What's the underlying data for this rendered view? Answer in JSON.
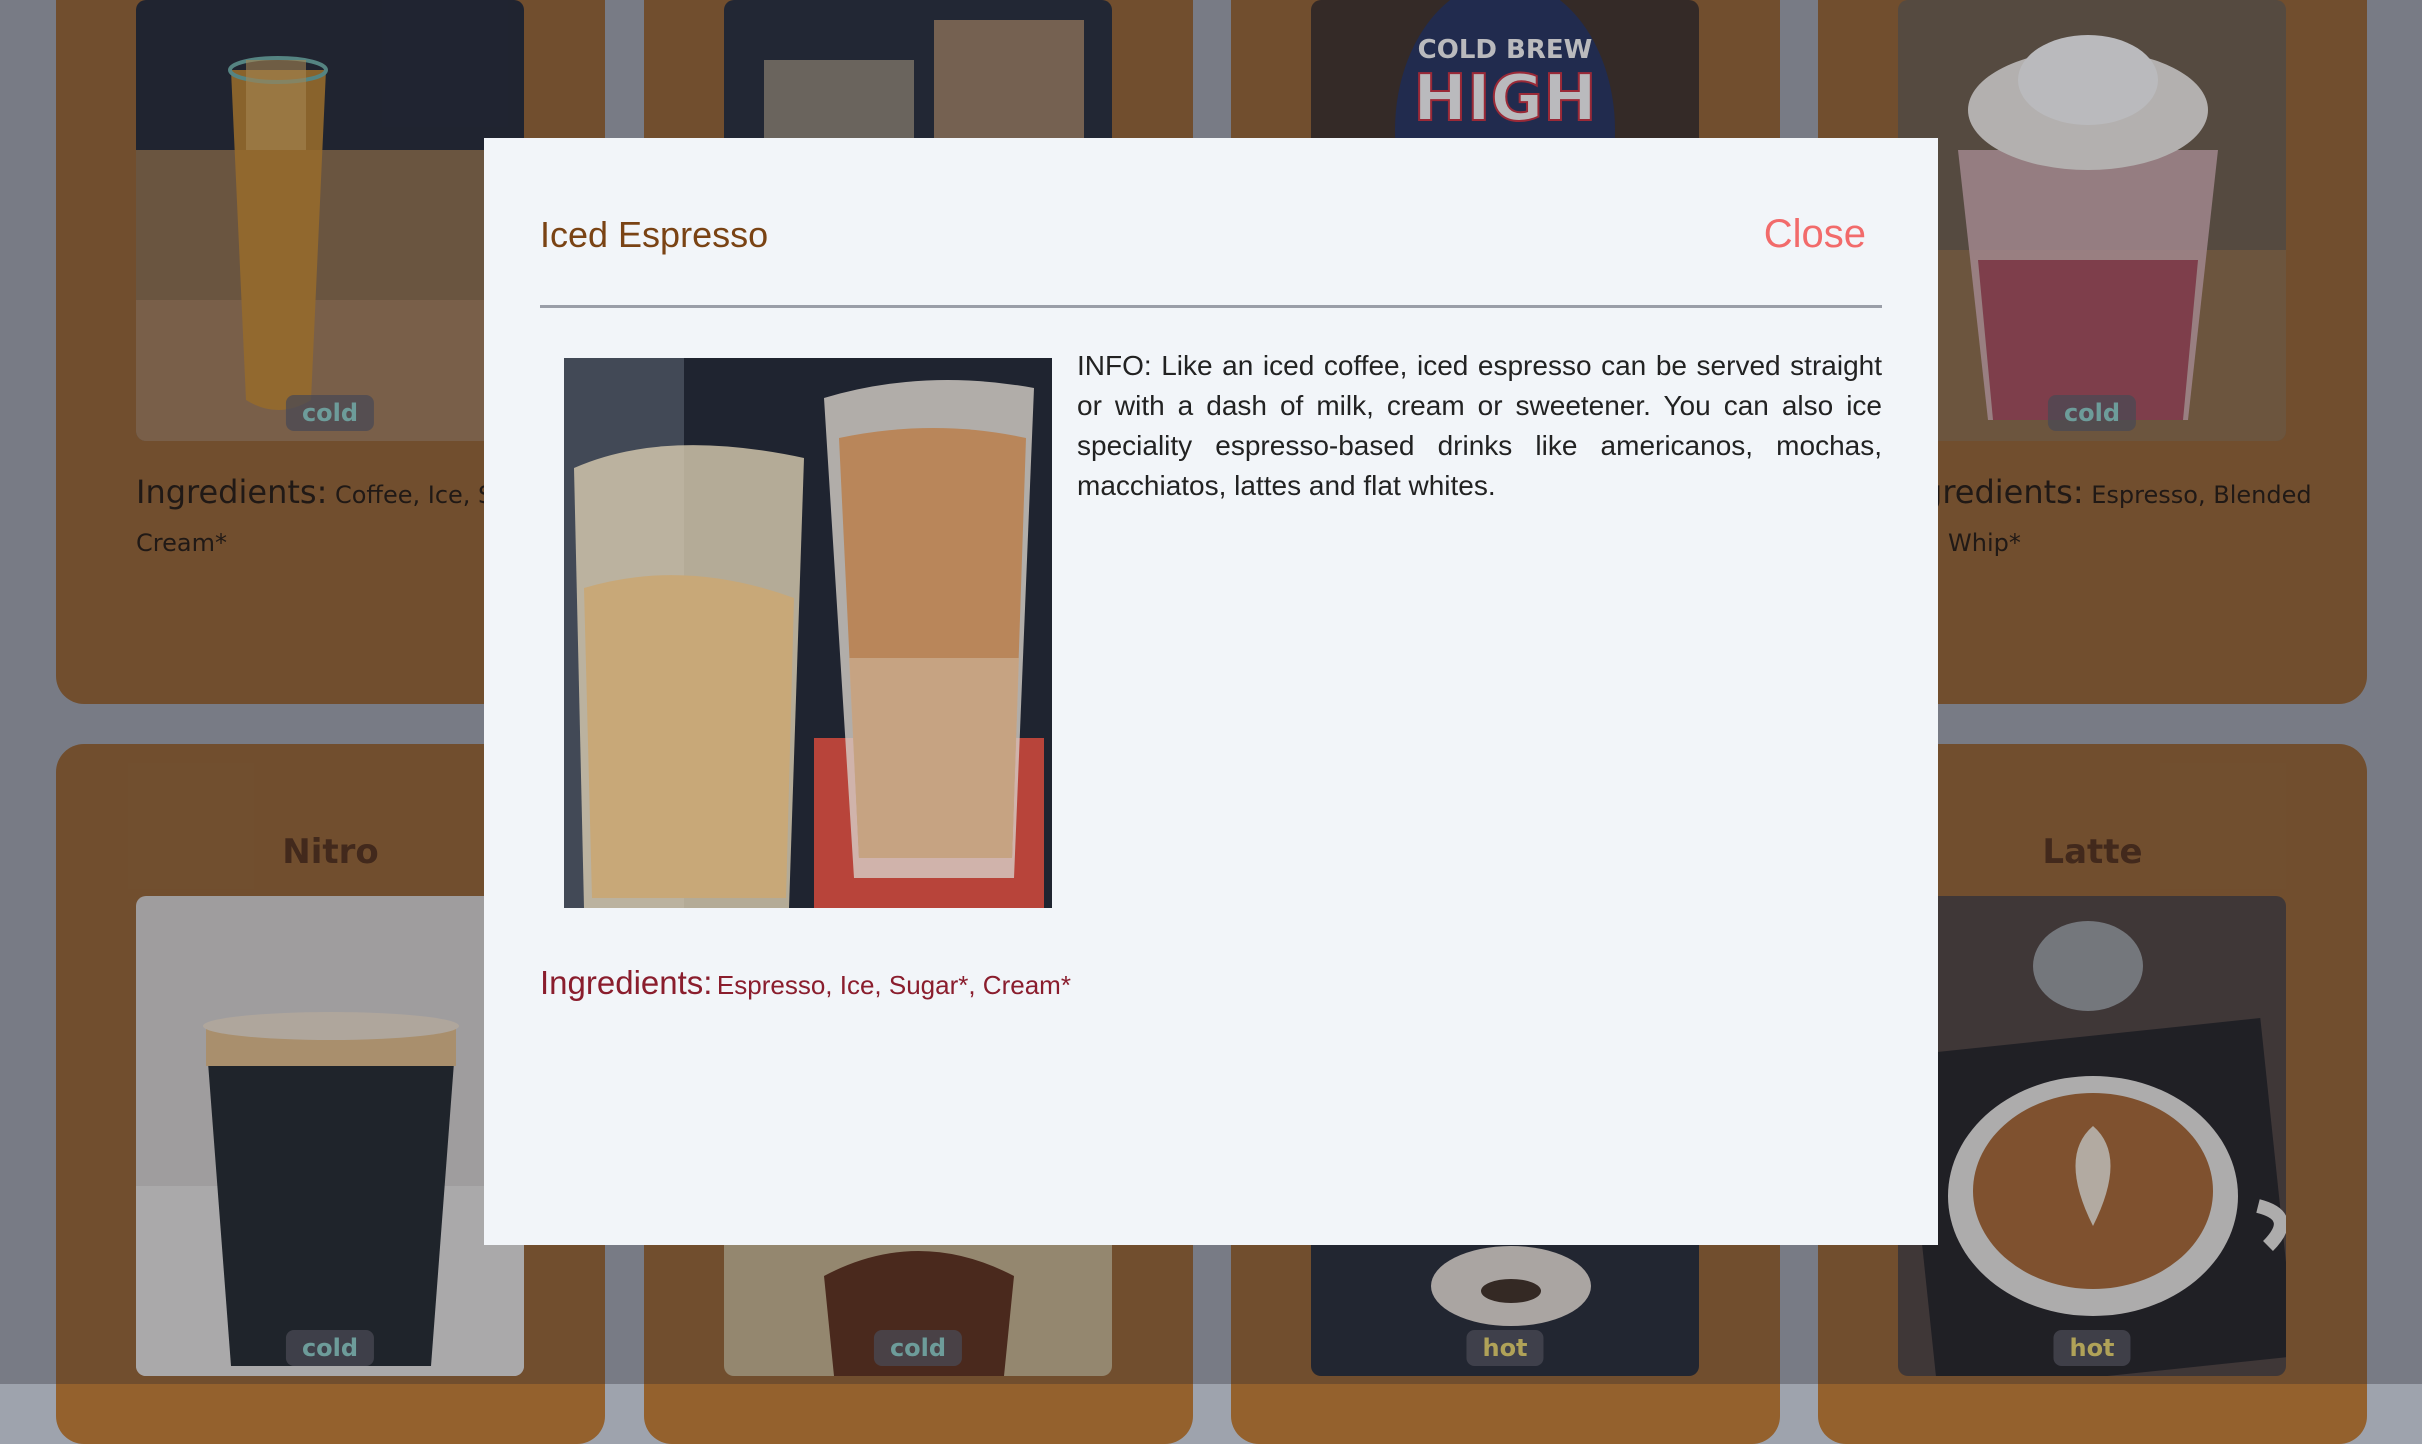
{
  "background_cards": [
    {
      "position": "row1-col1",
      "temp": "cold",
      "ingredients_label": "Ingredients:",
      "ingredients_text": "Coffee, Ice, Sug",
      "ingredients_text_2": "Cream*"
    },
    {
      "position": "row1-col2"
    },
    {
      "position": "row1-col3",
      "sign_line1": "COLD BREW",
      "sign_line2": "HIGH"
    },
    {
      "position": "row1-col4",
      "temp": "cold",
      "ingredients_label": "gredients:",
      "ingredients_text": "Espresso, Blended",
      "ingredients_text_2": "Whip*"
    },
    {
      "position": "row2-col1",
      "title": "Nitro",
      "temp": "cold"
    },
    {
      "position": "row2-col2",
      "temp": "cold"
    },
    {
      "position": "row2-col3",
      "temp": "hot"
    },
    {
      "position": "row2-col4",
      "title": "Latte",
      "temp": "hot"
    }
  ],
  "modal": {
    "title": "Iced Espresso",
    "close_label": "Close",
    "info": "INFO: Like an iced coffee, iced espresso can be served straight or with a dash of milk, cream or sweetener. You can also ice speciality espresso-based drinks like americanos, mochas, macchiatos, lattes and flat whites.",
    "ingredients_label": "Ingredients:",
    "ingredients_text": "Espresso, Ice, Sugar*, Cream*"
  },
  "colors": {
    "card_bg": "#94612d",
    "modal_bg": "#f2f5f9",
    "title": "#7a4314",
    "close": "#f26b6b",
    "ingredients": "#8a1d2d",
    "cold_badge": "#8ed3cc",
    "hot_badge": "#f0dc6a"
  }
}
